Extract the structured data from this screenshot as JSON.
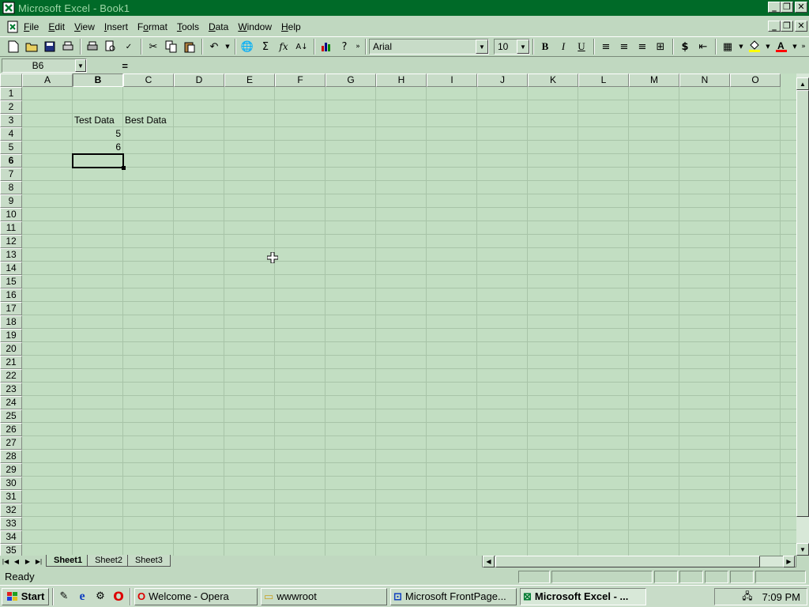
{
  "window": {
    "title": "Microsoft Excel - Book1"
  },
  "menu": [
    "File",
    "Edit",
    "View",
    "Insert",
    "Format",
    "Tools",
    "Data",
    "Window",
    "Help"
  ],
  "menu_underline": [
    "F",
    "E",
    "V",
    "I",
    "o",
    "T",
    "D",
    "W",
    "H"
  ],
  "toolbar": {
    "font": "Arial",
    "size": "10",
    "bold": "B",
    "italic": "I",
    "underline": "U",
    "currency": "$",
    "sum": "Σ",
    "fx": "fx"
  },
  "formula": {
    "name_box": "B6",
    "equals": "=",
    "value": ""
  },
  "columns": [
    "A",
    "B",
    "C",
    "D",
    "E",
    "F",
    "G",
    "H",
    "I",
    "J",
    "K",
    "L",
    "M",
    "N",
    "O"
  ],
  "rows": [
    "1",
    "2",
    "3",
    "4",
    "5",
    "6",
    "7",
    "8",
    "9",
    "10",
    "11",
    "12",
    "13",
    "14",
    "15",
    "16",
    "17",
    "18",
    "19",
    "20",
    "21",
    "22",
    "23",
    "24",
    "25",
    "26",
    "27",
    "28",
    "29",
    "30",
    "31",
    "32",
    "33",
    "34",
    "35"
  ],
  "cells": {
    "B3": "Test Data",
    "C3": "Best Data",
    "B4": "5",
    "B5": "6"
  },
  "selected": {
    "cell": "B6",
    "column": "B",
    "row": "6"
  },
  "sheets": [
    "Sheet1",
    "Sheet2",
    "Sheet3"
  ],
  "active_sheet": "Sheet1",
  "status": "Ready",
  "taskbar": {
    "start": "Start",
    "tasks": [
      "Welcome - Opera",
      "wwwroot",
      "Microsoft FrontPage...",
      "Microsoft Excel - ..."
    ],
    "active_task": "Microsoft Excel - ...",
    "clock": "7:09 PM"
  },
  "colors": {
    "title_bg": "#006a28",
    "sheet_bg": "#c2dec2",
    "chrome": "#c8dcc8"
  }
}
